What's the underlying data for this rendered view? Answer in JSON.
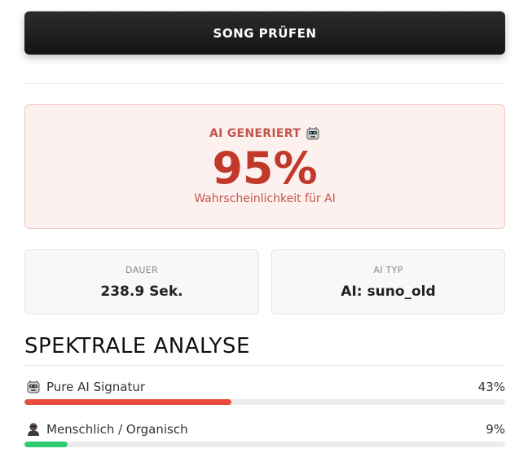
{
  "button": {
    "label": "SONG PRÜFEN"
  },
  "result": {
    "label": "AI GENERIERT",
    "icon": "robot-icon",
    "percent": "95%",
    "subtitle": "Wahrscheinlichkeit für AI",
    "accent_color": "#c0392b"
  },
  "stats": {
    "duration": {
      "label": "DAUER",
      "value": "238.9 Sek."
    },
    "ai_type": {
      "label": "AI TYP",
      "value": "AI: suno_old"
    }
  },
  "analysis": {
    "title": "SPEKTRALE ANALYSE",
    "metrics": [
      {
        "icon": "robot-icon",
        "label": "Pure AI Signatur",
        "value_text": "43%",
        "value": 0.43,
        "color": "#e74c3c"
      },
      {
        "icon": "person-icon",
        "label": "Menschlich / Organisch",
        "value_text": "9%",
        "value": 0.09,
        "color": "#2ecc71"
      }
    ]
  }
}
